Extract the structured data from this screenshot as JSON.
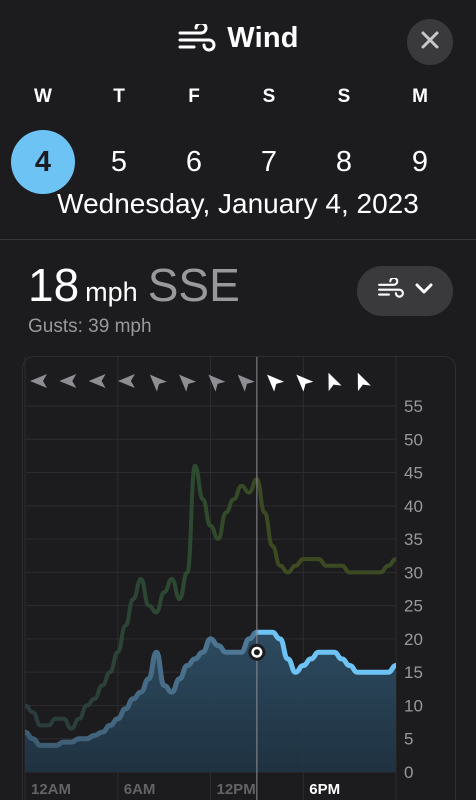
{
  "header": {
    "title": "Wind",
    "title_icon": "wind-icon",
    "close_icon": "close-icon"
  },
  "days": [
    {
      "letter": "W",
      "num": "4",
      "selected": true
    },
    {
      "letter": "T",
      "num": "5",
      "selected": false
    },
    {
      "letter": "F",
      "num": "6",
      "selected": false
    },
    {
      "letter": "S",
      "num": "7",
      "selected": false
    },
    {
      "letter": "S",
      "num": "8",
      "selected": false
    },
    {
      "letter": "M",
      "num": "9",
      "selected": false
    }
  ],
  "date_line": "Wednesday, January 4, 2023",
  "reading": {
    "speed": "18",
    "unit": "mph",
    "direction": "SSE",
    "gusts": "Gusts: 39 mph"
  },
  "mode_button": {
    "icon": "wind-icon",
    "chevron": "chevron-down-icon"
  },
  "colors": {
    "background": "#1c1c1e",
    "selected_day": "#6ec3f5",
    "wind_line": "#6ec3f5",
    "wind_fill": "#2f5068",
    "gust_line": "#3a4f2f"
  },
  "chart_data": {
    "type": "line",
    "xlabels": [
      "12AM",
      "6AM",
      "12PM",
      "6PM"
    ],
    "active_xlabel": "6PM",
    "ylim": [
      0,
      55
    ],
    "yticks": [
      0,
      5,
      10,
      15,
      20,
      25,
      30,
      35,
      40,
      45,
      50,
      55
    ],
    "x_hours": [
      0,
      0.5,
      1,
      1.5,
      2,
      2.5,
      3,
      3.5,
      4,
      4.5,
      5,
      5.5,
      6,
      6.5,
      7,
      7.5,
      8,
      8.5,
      9,
      9.5,
      10,
      10.5,
      11,
      11.5,
      12,
      12.5,
      13,
      13.5,
      14,
      14.5,
      15,
      15.5,
      16,
      16.5,
      17,
      17.5,
      18,
      18.5,
      19,
      19.5,
      20,
      20.5,
      21,
      21.5,
      22,
      22.5,
      23,
      23.5,
      24
    ],
    "current_hour": 15,
    "current_value": 18,
    "series": [
      {
        "values": [
          6,
          5,
          4,
          4,
          4,
          4.5,
          4.5,
          5,
          5,
          5.5,
          6,
          7,
          8,
          9.5,
          11,
          12,
          14,
          18,
          13,
          12,
          14,
          16,
          17,
          18,
          20,
          19,
          18,
          18,
          18,
          20,
          21,
          21,
          21,
          20,
          17,
          15,
          16,
          17,
          18,
          18,
          18,
          17,
          16,
          15,
          15,
          15,
          15,
          15,
          16
        ]
      },
      {
        "values": [
          10,
          9,
          7,
          7,
          8,
          8,
          6.5,
          8,
          10,
          11,
          13,
          15,
          18,
          22,
          26,
          29,
          25,
          24,
          27,
          29,
          26,
          30,
          46,
          41,
          37,
          35,
          39,
          41,
          43,
          42,
          44,
          39,
          34,
          31,
          30,
          31,
          32,
          32,
          32,
          31,
          31,
          31,
          30,
          30,
          30,
          30,
          30,
          31,
          32
        ]
      }
    ],
    "directions_deg": [
      270,
      270,
      270,
      270,
      315,
      315,
      315,
      315,
      315,
      315,
      337,
      337
    ],
    "direction_active_from_index": 8
  }
}
